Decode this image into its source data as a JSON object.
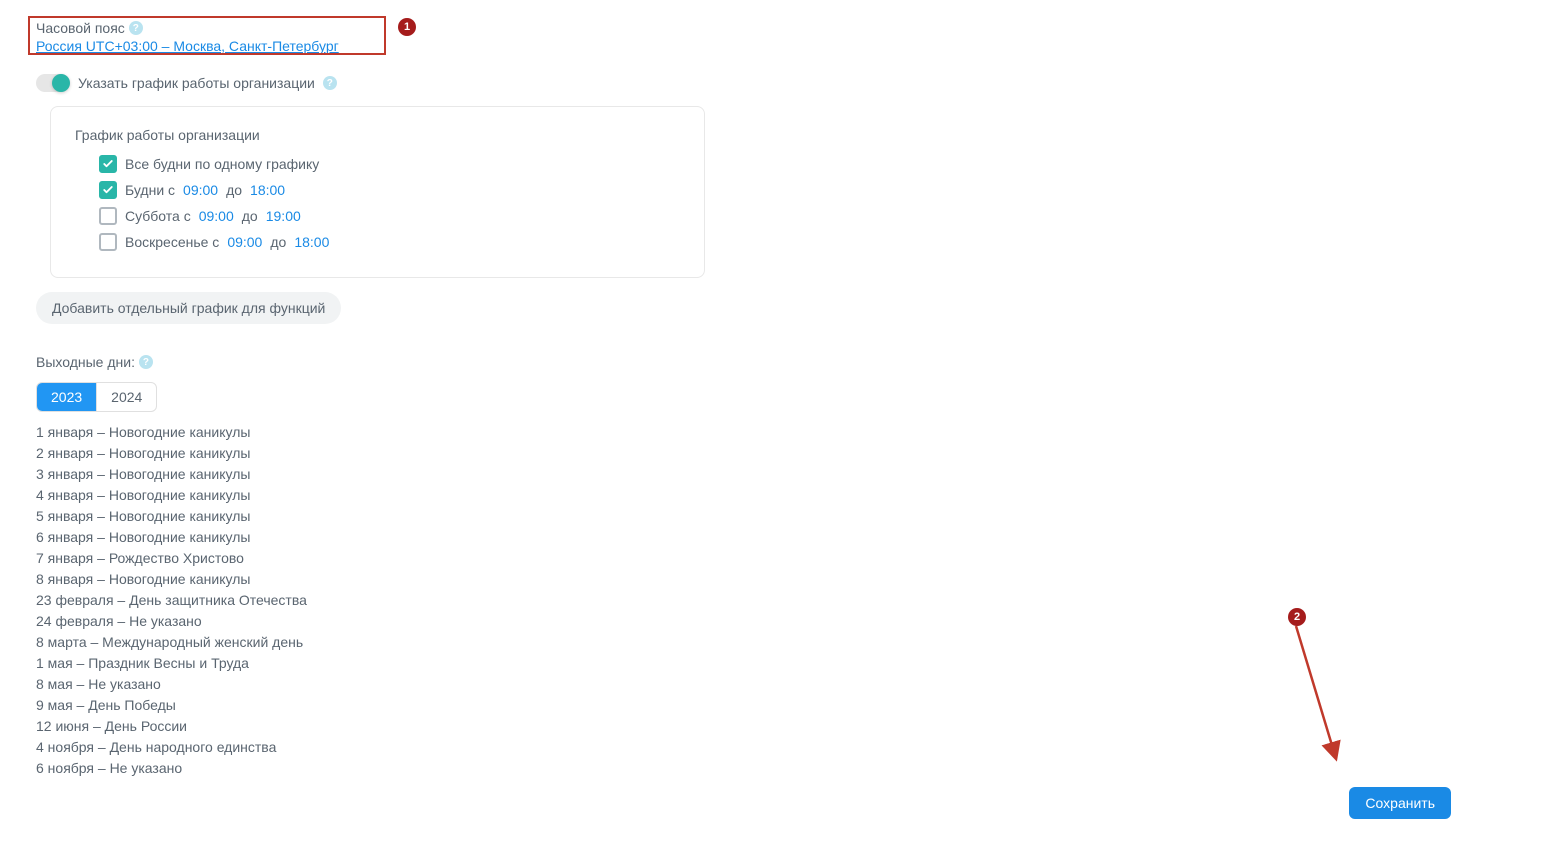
{
  "timezone": {
    "label": "Часовой пояс",
    "value": "Россия   UTC+03:00 – Москва, Санкт-Петербург"
  },
  "toggle": {
    "label": "Указать график работы организации"
  },
  "schedule": {
    "title": "График работы организации",
    "same_all_weekdays": "Все будни по одному графику",
    "weekdays_prefix": "Будни с",
    "saturday_prefix": "Суббота с",
    "sunday_prefix": "Воскресенье с",
    "to_word": "до",
    "weekdays_from": "09:00",
    "weekdays_to": "18:00",
    "sat_from": "09:00",
    "sat_to": "19:00",
    "sun_from": "09:00",
    "sun_to": "18:00"
  },
  "add_func_schedule_btn": "Добавить отдельный график для функций",
  "holidays": {
    "label": "Выходные дни:",
    "year_active": "2023",
    "year_other": "2024",
    "list": [
      "1 января – Новогодние каникулы",
      "2 января – Новогодние каникулы",
      "3 января – Новогодние каникулы",
      "4 января – Новогодние каникулы",
      "5 января – Новогодние каникулы",
      "6 января – Новогодние каникулы",
      "7 января – Рождество Христово",
      "8 января – Новогодние каникулы",
      "23 февраля – День защитника Отечества",
      "24 февраля – Не указано",
      "8 марта – Международный женский день",
      "1 мая – Праздник Весны и Труда",
      "8 мая – Не указано",
      "9 мая – День Победы",
      "12 июня – День России",
      "4 ноября – День народного единства",
      "6 ноября – Не указано"
    ]
  },
  "save_btn": "Сохранить",
  "annotations": {
    "one": "1",
    "two": "2"
  }
}
